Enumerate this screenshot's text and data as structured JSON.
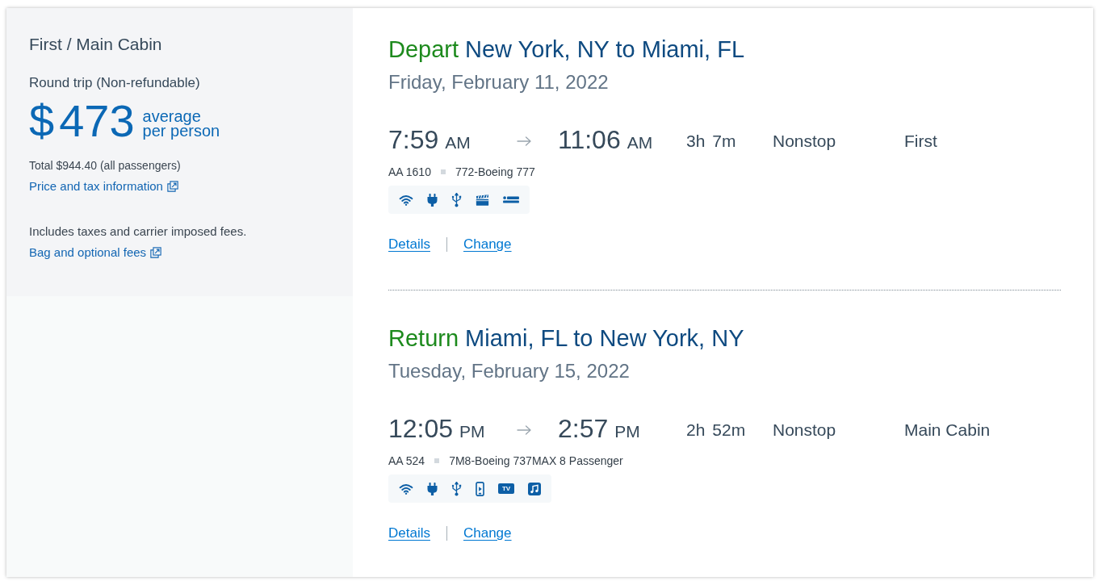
{
  "fare_summary": {
    "cabin": "First / Main Cabin",
    "trip_type": "Round trip (Non-refundable)",
    "price": {
      "currency": "$",
      "amount": "473",
      "caption": "average per person"
    },
    "total": "Total $944.40 (all passengers)",
    "price_link": "Price and tax information",
    "fees_note": "Includes taxes and carrier imposed fees.",
    "fees_link": "Bag and optional fees"
  },
  "slices": [
    {
      "direction": "Depart",
      "route": "New York, NY to Miami, FL",
      "date": "Friday, February 11, 2022",
      "departure": {
        "time": "7:59",
        "period": "AM"
      },
      "arrival": {
        "time": "11:06",
        "period": "AM"
      },
      "duration": {
        "hours": "3h",
        "minutes": "7m"
      },
      "stops": "Nonstop",
      "cabin": "First",
      "flight_number": "AA 1610",
      "aircraft": "772-Boeing 777",
      "amenities": [
        {
          "kind": "wifi"
        },
        {
          "kind": "power"
        },
        {
          "kind": "usb"
        },
        {
          "kind": "video"
        },
        {
          "kind": "lie-flat"
        }
      ],
      "links": [
        "Details",
        "Change"
      ]
    },
    {
      "direction": "Return",
      "route": "Miami, FL to New York, NY",
      "date": "Tuesday, February 15, 2022",
      "departure": {
        "time": "12:05",
        "period": "PM"
      },
      "arrival": {
        "time": "2:57",
        "period": "PM"
      },
      "duration": {
        "hours": "2h",
        "minutes": "52m"
      },
      "stops": "Nonstop",
      "cabin": "Main Cabin",
      "flight_number": "AA 524",
      "aircraft": "7M8-Boeing 737MAX 8 Passenger",
      "amenities": [
        {
          "kind": "wifi"
        },
        {
          "kind": "power"
        },
        {
          "kind": "usb"
        },
        {
          "kind": "device-streaming"
        },
        {
          "kind": "tv",
          "label": "TV"
        },
        {
          "kind": "music"
        }
      ],
      "links": [
        "Details",
        "Change"
      ]
    }
  ]
}
